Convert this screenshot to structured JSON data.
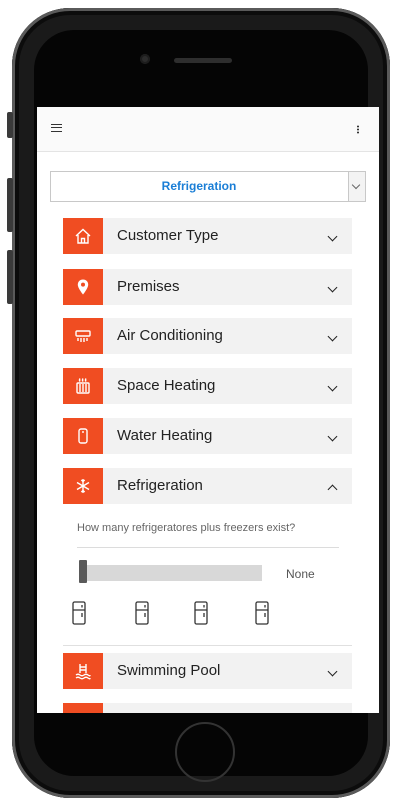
{
  "header": {
    "menu_icon": "hamburger-menu-icon",
    "more_icon": "more-vert-icon"
  },
  "category_select": {
    "selected": "Refrigeration",
    "arrow_icon": "chevron-down-icon"
  },
  "accordion": {
    "items": [
      {
        "label": "Customer Type",
        "icon": "house-icon",
        "expanded": false
      },
      {
        "label": "Premises",
        "icon": "location-pin-icon",
        "expanded": false
      },
      {
        "label": "Air Conditioning",
        "icon": "air-conditioner-icon",
        "expanded": false
      },
      {
        "label": "Space Heating",
        "icon": "heater-icon",
        "expanded": false
      },
      {
        "label": "Water Heating",
        "icon": "water-heater-icon",
        "expanded": false
      },
      {
        "label": "Refrigeration",
        "icon": "snowflake-icon",
        "expanded": true
      },
      {
        "label": "Swimming Pool",
        "icon": "swimming-pool-icon",
        "expanded": false
      }
    ]
  },
  "refrigeration_panel": {
    "question": "How many refrigeratores plus freezers exist?",
    "slider_value": 0,
    "slider_max": 4,
    "value_label": "None",
    "options": [
      "refrigerator-icon",
      "refrigerator-icon",
      "refrigerator-icon",
      "refrigerator-icon"
    ]
  },
  "colors": {
    "accent": "#f04d22",
    "select_text": "#1a7ed6",
    "row_bg": "#f2f2f2"
  }
}
